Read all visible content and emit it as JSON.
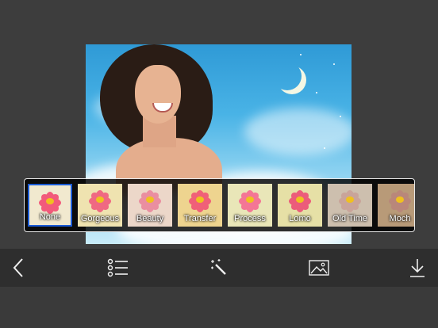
{
  "filters": [
    {
      "label": "None",
      "selected": true,
      "tint": "#f1e9cf",
      "petal": "#f25a7b"
    },
    {
      "label": "Gorgeous",
      "selected": false,
      "tint": "#efe3b0",
      "petal": "#f06982"
    },
    {
      "label": "Beauty",
      "selected": false,
      "tint": "#ecd7c9",
      "petal": "#ea8ea0"
    },
    {
      "label": "Transfer",
      "selected": false,
      "tint": "#eed48f",
      "petal": "#f06078"
    },
    {
      "label": "Process",
      "selected": false,
      "tint": "#e9e6b8",
      "petal": "#f47695"
    },
    {
      "label": "Lomo",
      "selected": false,
      "tint": "#e6e0a6",
      "petal": "#ec5c7a"
    },
    {
      "label": "Old Time",
      "selected": false,
      "tint": "#cdbfae",
      "petal": "#c9a49a"
    },
    {
      "label": "Moch",
      "selected": false,
      "tint": "#b89a78",
      "petal": "#b9877a"
    }
  ],
  "toolbar": {
    "back": "back-chevron-icon",
    "list": "list-icon",
    "magic": "magic-wand-icon",
    "image": "image-icon",
    "download": "download-icon"
  },
  "colors": {
    "background": "#3a3a3a",
    "toolbar": "#2e2e2e",
    "selection": "#1a5bd6",
    "sky": "#3aa6dd"
  }
}
